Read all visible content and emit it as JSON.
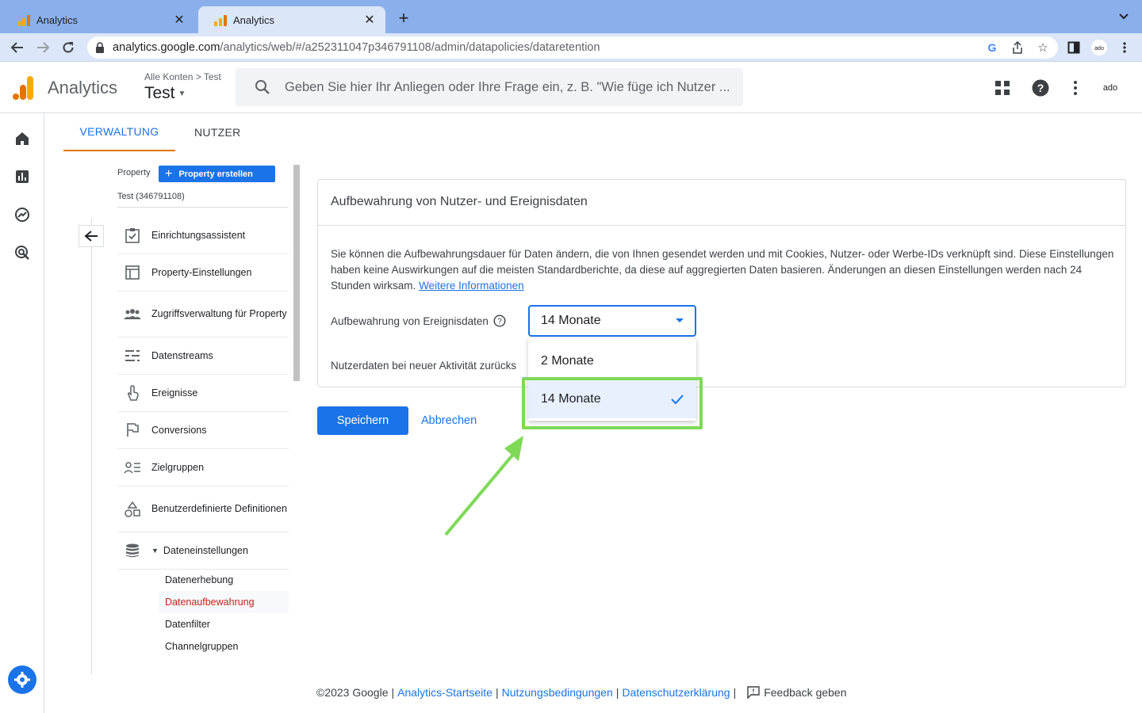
{
  "browser": {
    "tabs": [
      {
        "title": "Analytics",
        "active": false
      },
      {
        "title": "Analytics",
        "active": true
      }
    ],
    "url_host": "analytics.google.com",
    "url_path": "/analytics/web/#/a252311047p346791108/admin/datapolicies/dataretention",
    "profile_label": "ado"
  },
  "header": {
    "app_title": "Analytics",
    "breadcrumb_accounts": "Alle Konten",
    "breadcrumb_separator": ">",
    "breadcrumb_current": "Test",
    "property_name": "Test",
    "search_placeholder": "Geben Sie hier Ihr Anliegen oder Ihre Frage ein, z. B. \"Wie füge ich Nutzer ...",
    "profile_label": "ado"
  },
  "admin_tabs": [
    {
      "label": "VERWALTUNG",
      "active": true
    },
    {
      "label": "NUTZER",
      "active": false
    }
  ],
  "panel": {
    "property_label": "Property",
    "create_property_label": "Property erstellen",
    "property_id": "Test (346791108)",
    "menu_items": [
      {
        "label": "Einrichtungsassistent",
        "icon": "checklist-icon"
      },
      {
        "label": "Property-Einstellungen",
        "icon": "property-settings-icon"
      },
      {
        "label": "Zugriffsverwaltung für Property",
        "icon": "people-icon"
      },
      {
        "label": "Datenstreams",
        "icon": "datastreams-icon"
      },
      {
        "label": "Ereignisse",
        "icon": "touch-icon"
      },
      {
        "label": "Conversions",
        "icon": "flag-icon"
      },
      {
        "label": "Zielgruppen",
        "icon": "audience-icon"
      },
      {
        "label": "Benutzerdefinierte Definitionen",
        "icon": "shapes-icon"
      },
      {
        "label": "Dateneinstellungen",
        "icon": "database-icon"
      }
    ],
    "sub_items": [
      {
        "label": "Datenerhebung",
        "active": false
      },
      {
        "label": "Datenaufbewahrung",
        "active": true
      },
      {
        "label": "Datenfilter",
        "active": false
      },
      {
        "label": "Channelgruppen",
        "active": false
      }
    ]
  },
  "card": {
    "title": "Aufbewahrung von Nutzer- und Ereignisdaten",
    "description": "Sie können die Aufbewahrungsdauer für Daten ändern, die von Ihnen gesendet werden und mit Cookies, Nutzer- oder Werbe-IDs verknüpft sind. Diese Einstellungen haben keine Auswirkungen auf die meisten Standardberichte, da diese auf aggregierten Daten basieren. Änderungen an diesen Einstellungen werden nach 24 Stunden wirksam.",
    "learn_more": "Weitere Informationen",
    "event_retention_label": "Aufbewahrung von Ereignisdaten",
    "reset_label": "Nutzerdaten bei neuer Aktivität zurücks",
    "selected_value": "14 Monate",
    "options": [
      {
        "label": "2 Monate",
        "selected": false
      },
      {
        "label": "14 Monate",
        "selected": true
      }
    ]
  },
  "actions": {
    "save": "Speichern",
    "cancel": "Abbrechen"
  },
  "footer": {
    "copyright": "©2023 Google",
    "link_home": "Analytics-Startseite",
    "link_terms": "Nutzungsbedingungen",
    "link_privacy": "Datenschutzerklärung",
    "feedback": "Feedback geben",
    "separator": "|"
  },
  "colors": {
    "accent": "#1a73e8",
    "active_tab_underline": "#e37400",
    "active_subitem": "#c5221f",
    "annotation": "#7ed957"
  }
}
